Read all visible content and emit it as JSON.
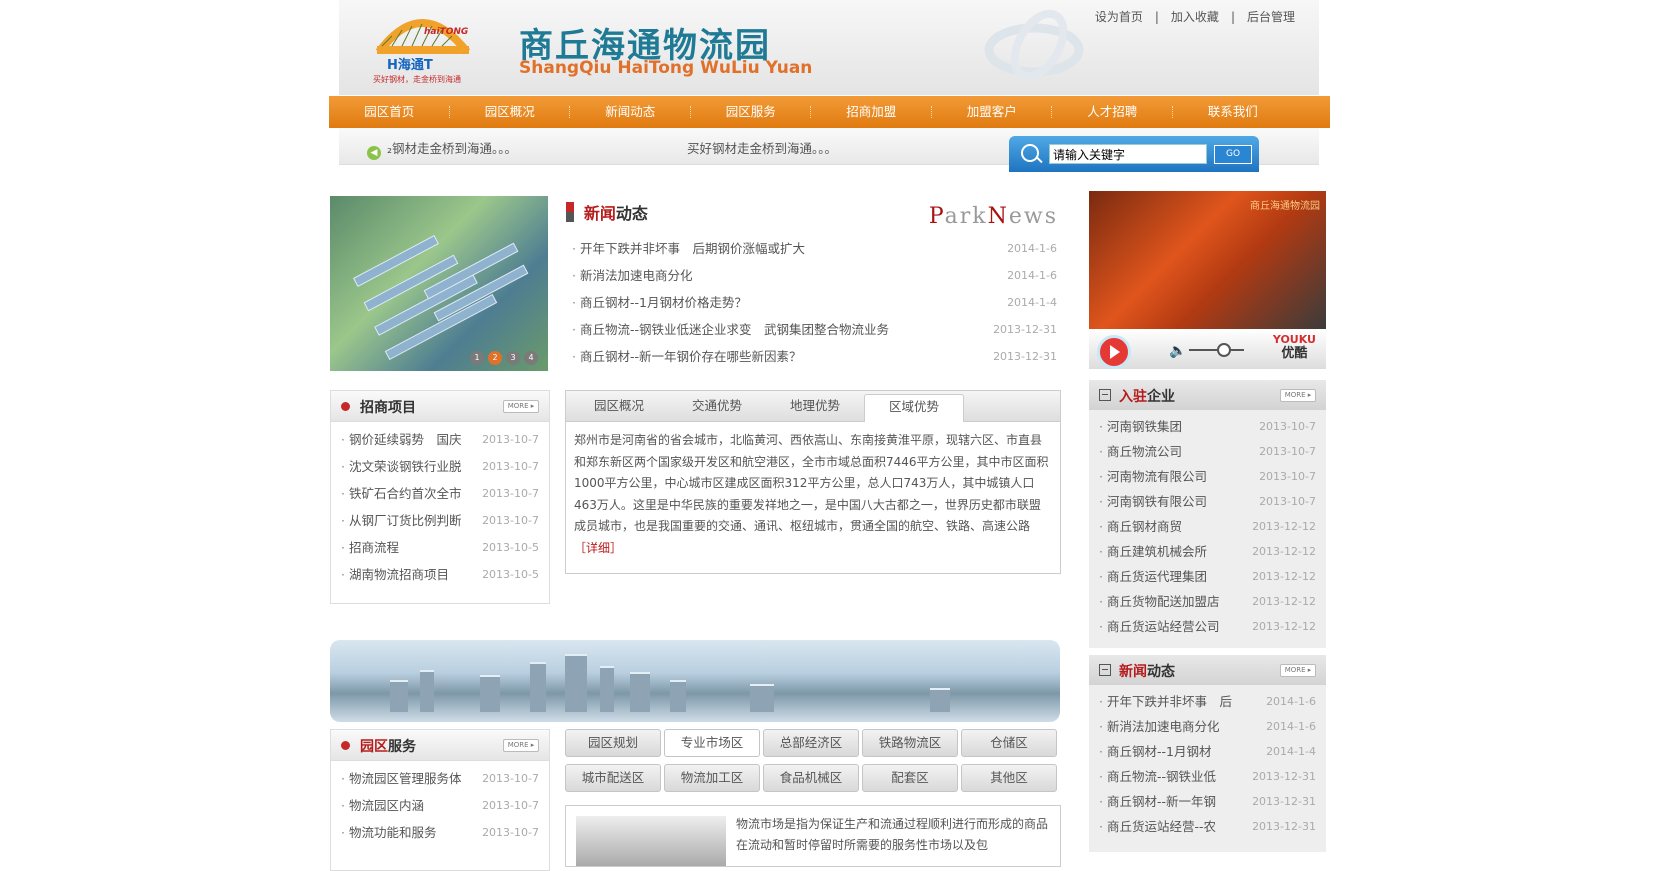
{
  "header": {
    "logo_text": "haiTONG",
    "logo_sub": "H海通T",
    "logo_slogan": "买好钢材，走金桥到海通",
    "title": "商丘海通物流园",
    "subtitle": "ShangQiu HaiTong WuLiu Yuan",
    "toplinks": [
      "设为首页",
      "|",
      "加入收藏",
      "|",
      "后台管理"
    ]
  },
  "nav": [
    "园区首页",
    "园区概况",
    "新闻动态",
    "园区服务",
    "招商加盟",
    "加盟客户",
    "人才招聘",
    "联系我们"
  ],
  "marquee": [
    "₂钢材走金桥到海通。。。",
    "买好钢材走金桥到海通。。。"
  ],
  "search": {
    "value": "请输入关键字",
    "go_label": "GO"
  },
  "slider_dots": [
    "1",
    "2",
    "3",
    "4"
  ],
  "news": {
    "title_red": "新闻",
    "title_rest": "动态",
    "park_p": "P",
    "park_ark": "ark",
    "park_n": "N",
    "park_ews": "ews",
    "items": [
      {
        "t": "开年下跌并非坏事　后期钢价涨幅或扩大",
        "d": "2014-1-6"
      },
      {
        "t": "新消法加速电商分化",
        "d": "2014-1-6"
      },
      {
        "t": "商丘钢材--1月钢材价格走势？",
        "d": "2014-1-4"
      },
      {
        "t": "商丘物流--钢铁业低迷企业求变　武钢集团整合物流业务",
        "d": "2013-12-31"
      },
      {
        "t": "商丘钢材--新一年钢价存在哪些新因素？",
        "d": "2013-12-31"
      }
    ]
  },
  "zhaoshang": {
    "title": "招商项目",
    "more": "MORE ▸",
    "items": [
      {
        "t": "钢价延续弱势　国庆",
        "d": "2013-10-7"
      },
      {
        "t": "沈文荣谈钢铁行业脱",
        "d": "2013-10-7"
      },
      {
        "t": "铁矿石合约首次全市",
        "d": "2013-10-7"
      },
      {
        "t": "从钢厂订货比例判断",
        "d": "2013-10-7"
      },
      {
        "t": "招商流程",
        "d": "2013-10-5"
      },
      {
        "t": "湖南物流招商项目",
        "d": "2013-10-5"
      }
    ]
  },
  "tabs": {
    "labels": [
      "园区概况",
      "交通优势",
      "地理优势",
      "区域优势"
    ],
    "content": "郑州市是河南省的省会城市，北临黄河、西依嵩山、东南接黄淮平原，现辖六区、市直县和郑东新区两个国家级开发区和航空港区，全市市域总面积7446平方公里，其中市区面积1000平方公里，中心城市区建成区面积312平方公里，总人口743万人，其中城镇人口463万人。这里是中华民族的重要发祥地之一，是中国八大古都之一，世界历史都市联盟成员城市，也是我国重要的交通、通讯、枢纽城市，贯通全国的航空、铁路、高速公路",
    "detail": "［详细］"
  },
  "service": {
    "title_red": "园区",
    "title_rest": "服务",
    "more": "MORE ▸",
    "items": [
      {
        "t": "物流园区管理服务体",
        "d": "2013-10-7"
      },
      {
        "t": "物流园区内涵",
        "d": "2013-10-7"
      },
      {
        "t": "物流功能和服务",
        "d": "2013-10-7"
      }
    ]
  },
  "zones": [
    "园区规划",
    "专业市场区",
    "总部经济区",
    "铁路物流区",
    "仓储区",
    "城市配送区",
    "物流加工区",
    "食品机械区",
    "配套区",
    "其他区"
  ],
  "intro": {
    "text": "物流市场是指为保证生产和流通过程顺利进行而形成的商品在流动和暂时停留时所需要的服务性市场以及包"
  },
  "video": {
    "watermark": "商丘海通物流园",
    "youku_en": "YOUKU",
    "youku_cn": "优酷"
  },
  "companies": {
    "title_red": "入驻",
    "title_rest": "企业",
    "more": "MORE ▸",
    "items": [
      {
        "t": "河南钢铁集团",
        "d": "2013-10-7"
      },
      {
        "t": "商丘物流公司",
        "d": "2013-10-7"
      },
      {
        "t": "河南物流有限公司",
        "d": "2013-10-7"
      },
      {
        "t": "河南钢铁有限公司",
        "d": "2013-10-7"
      },
      {
        "t": "商丘钢材商贸",
        "d": "2013-12-12"
      },
      {
        "t": "商丘建筑机械会所",
        "d": "2013-12-12"
      },
      {
        "t": "商丘货运代理集团",
        "d": "2013-12-12"
      },
      {
        "t": "商丘货物配送加盟店",
        "d": "2013-12-12"
      },
      {
        "t": "商丘货运站经营公司",
        "d": "2013-12-12"
      }
    ]
  },
  "rnews": {
    "title_red": "新闻",
    "title_rest": "动态",
    "more": "MORE ▸",
    "items": [
      {
        "t": "开年下跌并非坏事　后",
        "d": "2014-1-6"
      },
      {
        "t": "新消法加速电商分化",
        "d": "2014-1-6"
      },
      {
        "t": "商丘钢材--1月钢材",
        "d": "2014-1-4"
      },
      {
        "t": "商丘物流--钢铁业低",
        "d": "2013-12-31"
      },
      {
        "t": "商丘钢材--新一年钢",
        "d": "2013-12-31"
      },
      {
        "t": "商丘货运站经营--农",
        "d": "2013-12-31"
      }
    ]
  },
  "colors": {
    "nav": "#e8870f",
    "accent_red": "#b71c1c",
    "title_blue": "#1f7a95",
    "search_blue": "#1f74c0"
  }
}
